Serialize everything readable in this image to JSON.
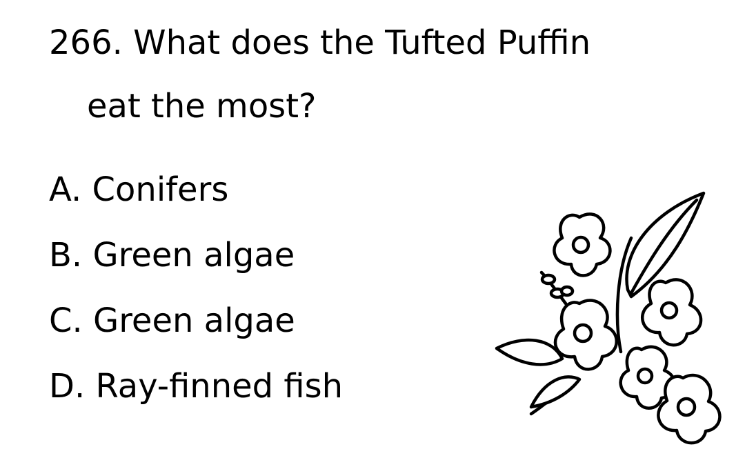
{
  "question": {
    "line1": "266. What does the Tufted Puffin",
    "line2": "eat the most?"
  },
  "options": [
    {
      "text": "A. Conifers"
    },
    {
      "text": "B. Green algae"
    },
    {
      "text": "C. Green algae"
    },
    {
      "text": "D. Ray-finned fish"
    }
  ],
  "illustration": {
    "icon": "flower-bouquet-icon"
  }
}
